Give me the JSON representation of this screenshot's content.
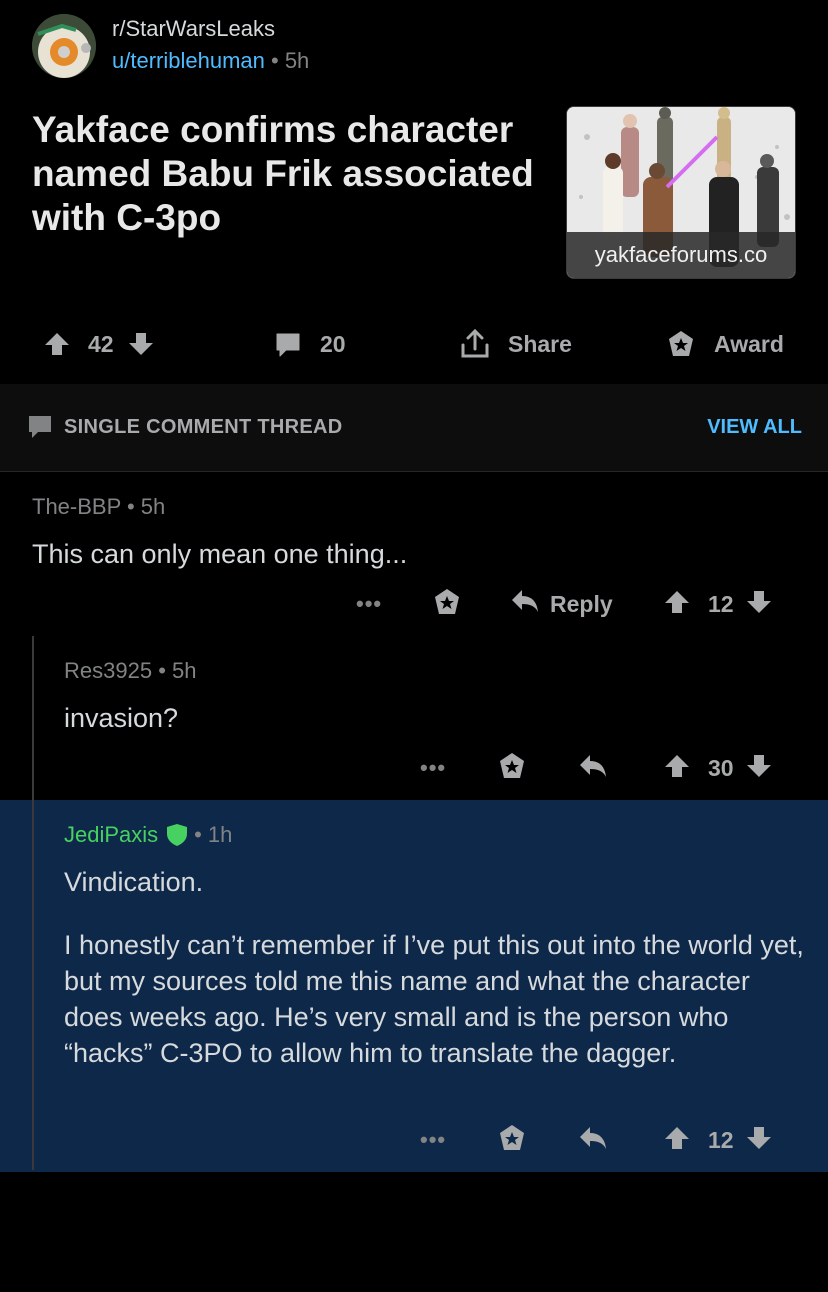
{
  "post": {
    "subreddit": "r/StarWarsLeaks",
    "author": "u/terriblehuman",
    "age": "5h",
    "title": "Yakface confirms character named Babu Frik associated with C-3po",
    "link_domain": "yakfaceforums.co",
    "score": "42",
    "comments": "20",
    "share_label": "Share",
    "award_label": "Award"
  },
  "thread": {
    "label": "SINGLE COMMENT THREAD",
    "view_all": "VIEW ALL"
  },
  "comments": [
    {
      "author": "The-BBP",
      "age": "5h",
      "body": "This can only mean one thing...",
      "reply_label": "Reply",
      "score": "12"
    },
    {
      "author": "Res3925",
      "age": "5h",
      "body": "invasion?",
      "score": "30"
    },
    {
      "author": "JediPaxis",
      "age": "1h",
      "body_p1": "Vindication.",
      "body_p2": "I honestly can’t remember if I’ve put this out into the world yet, but my sources told me this name and what the character does weeks ago. He’s very small and is the person who “hacks” C-3PO to allow him to translate the dagger.",
      "score": "12"
    }
  ],
  "colors": {
    "background": "#000000",
    "link_blue": "#4fbcff",
    "highlight_bg": "#0d2849",
    "mod_green": "#46d160"
  }
}
